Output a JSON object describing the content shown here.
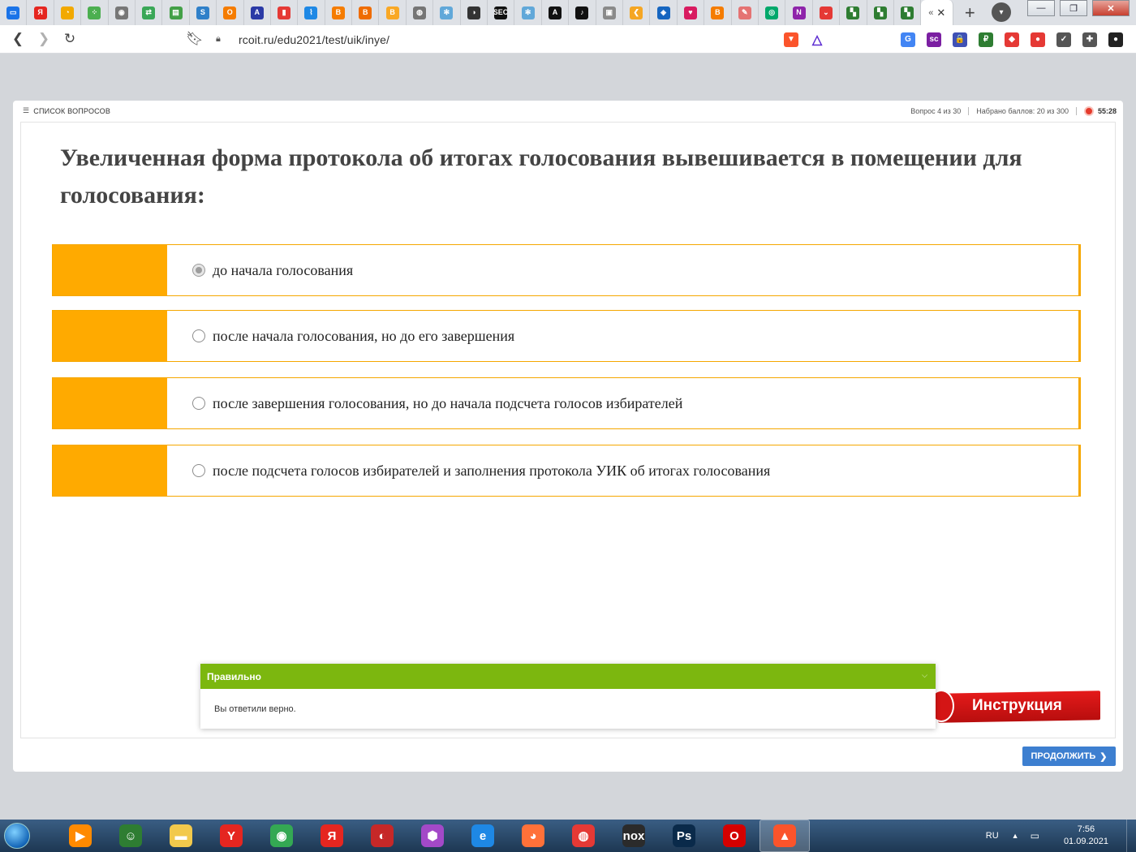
{
  "browser": {
    "tabs": [
      {
        "icon": "chat-icon",
        "glyph": "▭",
        "color": "#1a73e8"
      },
      {
        "icon": "yandex-icon",
        "glyph": "Я",
        "color": "#e52620"
      },
      {
        "icon": "swirl-icon",
        "glyph": "◔",
        "color": "#f2a900"
      },
      {
        "icon": "dots-icon",
        "glyph": "⁘",
        "color": "#4caf50"
      },
      {
        "icon": "eye-icon",
        "glyph": "◉",
        "color": "#777777"
      },
      {
        "icon": "arrows-icon",
        "glyph": "⇄",
        "color": "#3aa757"
      },
      {
        "icon": "pages-icon",
        "glyph": "▤",
        "color": "#43a047"
      },
      {
        "icon": "serp24-icon",
        "glyph": "S",
        "color": "#2f80c9"
      },
      {
        "icon": "onlysurf-icon",
        "glyph": "O",
        "color": "#f57c00"
      },
      {
        "icon": "analytics-icon",
        "glyph": "A",
        "color": "#2b3aa6"
      },
      {
        "icon": "bars-icon",
        "glyph": "▮",
        "color": "#e53935"
      },
      {
        "icon": "link-icon",
        "glyph": "⌇",
        "color": "#1e88e5"
      },
      {
        "icon": "blogger-icon",
        "glyph": "B",
        "color": "#f57c00"
      },
      {
        "icon": "blogger-icon",
        "glyph": "B",
        "color": "#ef6c00"
      },
      {
        "icon": "blogger-icon",
        "glyph": "B",
        "color": "#f9a825"
      },
      {
        "icon": "globe-icon",
        "glyph": "◍",
        "color": "#757575"
      },
      {
        "icon": "react-icon",
        "glyph": "✻",
        "color": "#61a8d9"
      },
      {
        "icon": "eye-dark-icon",
        "glyph": "◑",
        "color": "#333333"
      },
      {
        "icon": "seo-icon",
        "glyph": "SEO",
        "color": "#111111"
      },
      {
        "icon": "react-icon",
        "glyph": "✻",
        "color": "#61a8d9"
      },
      {
        "icon": "a-letter-icon",
        "glyph": "A",
        "color": "#111111"
      },
      {
        "icon": "tiktok-icon",
        "glyph": "♪",
        "color": "#111111"
      },
      {
        "icon": "box-icon",
        "glyph": "▣",
        "color": "#8a8a8a"
      },
      {
        "icon": "arrow-left-icon",
        "glyph": "❮",
        "color": "#f5a623"
      },
      {
        "icon": "shield-icon",
        "glyph": "◈",
        "color": "#1565c0"
      },
      {
        "icon": "heart-icon",
        "glyph": "♥",
        "color": "#d81b60"
      },
      {
        "icon": "blogger-icon",
        "glyph": "B",
        "color": "#f57c00"
      },
      {
        "icon": "pen-icon",
        "glyph": "✎",
        "color": "#e57373"
      },
      {
        "icon": "ring-icon",
        "glyph": "◎",
        "color": "#00a86b"
      },
      {
        "icon": "n-letter-icon",
        "glyph": "N",
        "color": "#8e24aa"
      },
      {
        "icon": "pocket-icon",
        "glyph": "⌄",
        "color": "#e53935"
      },
      {
        "icon": "team-icon",
        "glyph": "▚",
        "color": "#2e7d32"
      },
      {
        "icon": "team-icon",
        "glyph": "▚",
        "color": "#2e7d32"
      },
      {
        "icon": "team-icon",
        "glyph": "▚",
        "color": "#2e7d32"
      }
    ],
    "active_tab": {
      "label": "«",
      "close": "✕"
    },
    "new_tab": "+",
    "window_buttons": {
      "minimize": "—",
      "maximize": "❐",
      "close": "✕"
    },
    "url": "rcoit.ru/edu2021/test/uik/inye/",
    "extensions": [
      {
        "icon": "translate-icon",
        "glyph": "G",
        "color": "#4285f4"
      },
      {
        "icon": "sc-icon",
        "glyph": "sc",
        "color": "#7b1fa2"
      },
      {
        "icon": "lock-ext-icon",
        "glyph": "🔒",
        "color": "#3f51b5"
      },
      {
        "icon": "ruble-icon",
        "glyph": "₽",
        "color": "#2e7d32"
      },
      {
        "icon": "cube-icon",
        "glyph": "◆",
        "color": "#e53935"
      },
      {
        "icon": "record-icon",
        "glyph": "●",
        "color": "#e53935"
      },
      {
        "icon": "shield-check-icon",
        "glyph": "✓",
        "color": "#555555"
      },
      {
        "icon": "puzzle-icon",
        "glyph": "✚",
        "color": "#555555"
      },
      {
        "icon": "profile-icon",
        "glyph": "●",
        "color": "#222222"
      }
    ]
  },
  "quiz": {
    "questions_list_label": "СПИСОК ВОПРОСОВ",
    "progress": "Вопрос 4 из 30",
    "score": "Набрано баллов: 20 из 300",
    "timer": "55:28",
    "question": "Увеличенная форма протокола об итогах голосования вывешивается в помещении для голосования:",
    "answers": [
      {
        "text": "до начала голосования",
        "selected": true
      },
      {
        "text": "после начала голосования, но до его завершения",
        "selected": false
      },
      {
        "text": "после завершения голосования, но до начала подсчета голосов избирателей",
        "selected": false
      },
      {
        "text": "после подсчета голосов избирателей и заполнения протокола УИК об итогах голосования",
        "selected": false
      }
    ],
    "feedback": {
      "title": "Правильно",
      "message": "Вы ответили верно."
    },
    "instruction_label": "Инструкция",
    "continue_label": "ПРОДОЛЖИТЬ",
    "accent_color": "#ffaa00",
    "correct_color": "#7cb70f",
    "button_color": "#3d7fd0"
  },
  "taskbar": {
    "apps": [
      {
        "icon": "video-player-icon",
        "glyph": "▶",
        "color": "#ff8a00"
      },
      {
        "icon": "user-card-icon",
        "glyph": "☺",
        "color": "#2e7d32"
      },
      {
        "icon": "folder-icon",
        "glyph": "▬",
        "color": "#f2c94c"
      },
      {
        "icon": "yandex-browser-icon",
        "glyph": "Y",
        "color": "#e52620"
      },
      {
        "icon": "chrome-icon",
        "glyph": "◉",
        "color": "#34a853"
      },
      {
        "icon": "yandex-icon",
        "glyph": "Я",
        "color": "#e52620"
      },
      {
        "icon": "antivirus-icon",
        "glyph": "◐",
        "color": "#c62828"
      },
      {
        "icon": "polygon-icon",
        "glyph": "⬢",
        "color": "#a349c8"
      },
      {
        "icon": "ie-icon",
        "glyph": "e",
        "color": "#1e88e5"
      },
      {
        "icon": "firefox-icon",
        "glyph": "◕",
        "color": "#ff7139"
      },
      {
        "icon": "cc-icon",
        "glyph": "◍",
        "color": "#e53935"
      },
      {
        "icon": "nox-icon",
        "glyph": "nox",
        "color": "#2b2b2b"
      },
      {
        "icon": "photoshop-icon",
        "glyph": "Ps",
        "color": "#0a2a4a"
      },
      {
        "icon": "opera-icon",
        "glyph": "O",
        "color": "#d50000"
      },
      {
        "icon": "brave-icon",
        "glyph": "▲",
        "color": "#fb542b"
      }
    ],
    "language": "RU",
    "tray_arrow": "▲",
    "time": "7:56",
    "date": "01.09.2021"
  }
}
